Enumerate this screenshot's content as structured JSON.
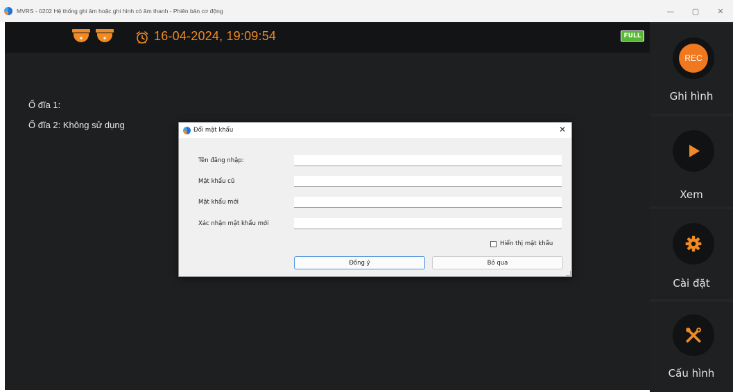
{
  "window": {
    "title": "MVRS - 0202 Hệ thống ghi âm hoặc ghi hình có âm thanh - Phiên bản cơ động",
    "minimize": "—",
    "restore": "▢",
    "close": "✕"
  },
  "topbar": {
    "datetime": "16-04-2024, 19:09:54",
    "full_badge": "FULL"
  },
  "disks": [
    "Ổ đĩa 1:",
    "Ổ đĩa 2: Không sử dụng"
  ],
  "sidebar": {
    "items": [
      {
        "label": "Ghi hình",
        "icon_text": "REC",
        "icon": "rec-icon"
      },
      {
        "label": "Xem",
        "icon": "play-icon"
      },
      {
        "label": "Cài đặt",
        "icon": "gear-icon"
      },
      {
        "label": "Cấu hình",
        "icon": "tools-icon"
      }
    ]
  },
  "dialog": {
    "title": "Đổi mật khẩu",
    "close": "✕",
    "fields": [
      {
        "label": "Tên đăng nhập:",
        "value": ""
      },
      {
        "label": "Mật khẩu cũ",
        "value": ""
      },
      {
        "label": "Mật khẩu mới",
        "value": ""
      },
      {
        "label": "Xác nhận mật khẩu mới",
        "value": ""
      }
    ],
    "show_password_label": "Hiển thị mật khẩu",
    "show_password_checked": false,
    "ok_label": "Đồng ý",
    "cancel_label": "Bỏ qua"
  },
  "colors": {
    "accent": "#f08a24",
    "background": "#1e1f21",
    "full_badge": "#56b833"
  }
}
